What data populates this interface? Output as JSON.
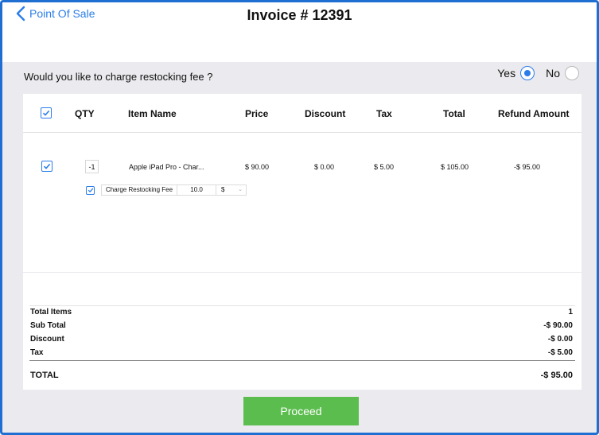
{
  "header": {
    "back_label": "Point Of Sale",
    "title": "Invoice # 12391"
  },
  "restock": {
    "question": "Would you like to charge restocking fee ?",
    "yes_label": "Yes",
    "no_label": "No",
    "selected": "Yes"
  },
  "table": {
    "columns": [
      "QTY",
      "Item Name",
      "Price",
      "Discount",
      "Tax",
      "Total",
      "Refund Amount"
    ],
    "row": {
      "checked": true,
      "qty": "-1",
      "item_name": "Apple iPad Pro - Char...",
      "price": "$ 90.00",
      "discount": "$ 0.00",
      "tax": "$ 5.00",
      "total": "$ 105.00",
      "refund_amount": "-$ 95.00"
    },
    "fee": {
      "checked": true,
      "label": "Charge Restocking Fee",
      "value": "10.0",
      "unit": "$"
    }
  },
  "summary": {
    "total_items_label": "Total Items",
    "total_items_value": "1",
    "sub_total_label": "Sub Total",
    "sub_total_value": "-$ 90.00",
    "discount_label": "Discount",
    "discount_value": "-$ 0.00",
    "tax_label": "Tax",
    "tax_value": "-$ 5.00",
    "total_label": "TOTAL",
    "total_value": "-$ 95.00"
  },
  "actions": {
    "proceed_label": "Proceed"
  },
  "colors": {
    "accent": "#2b7de9",
    "proceed": "#5cbd4f",
    "frame": "#1f6fd2"
  }
}
